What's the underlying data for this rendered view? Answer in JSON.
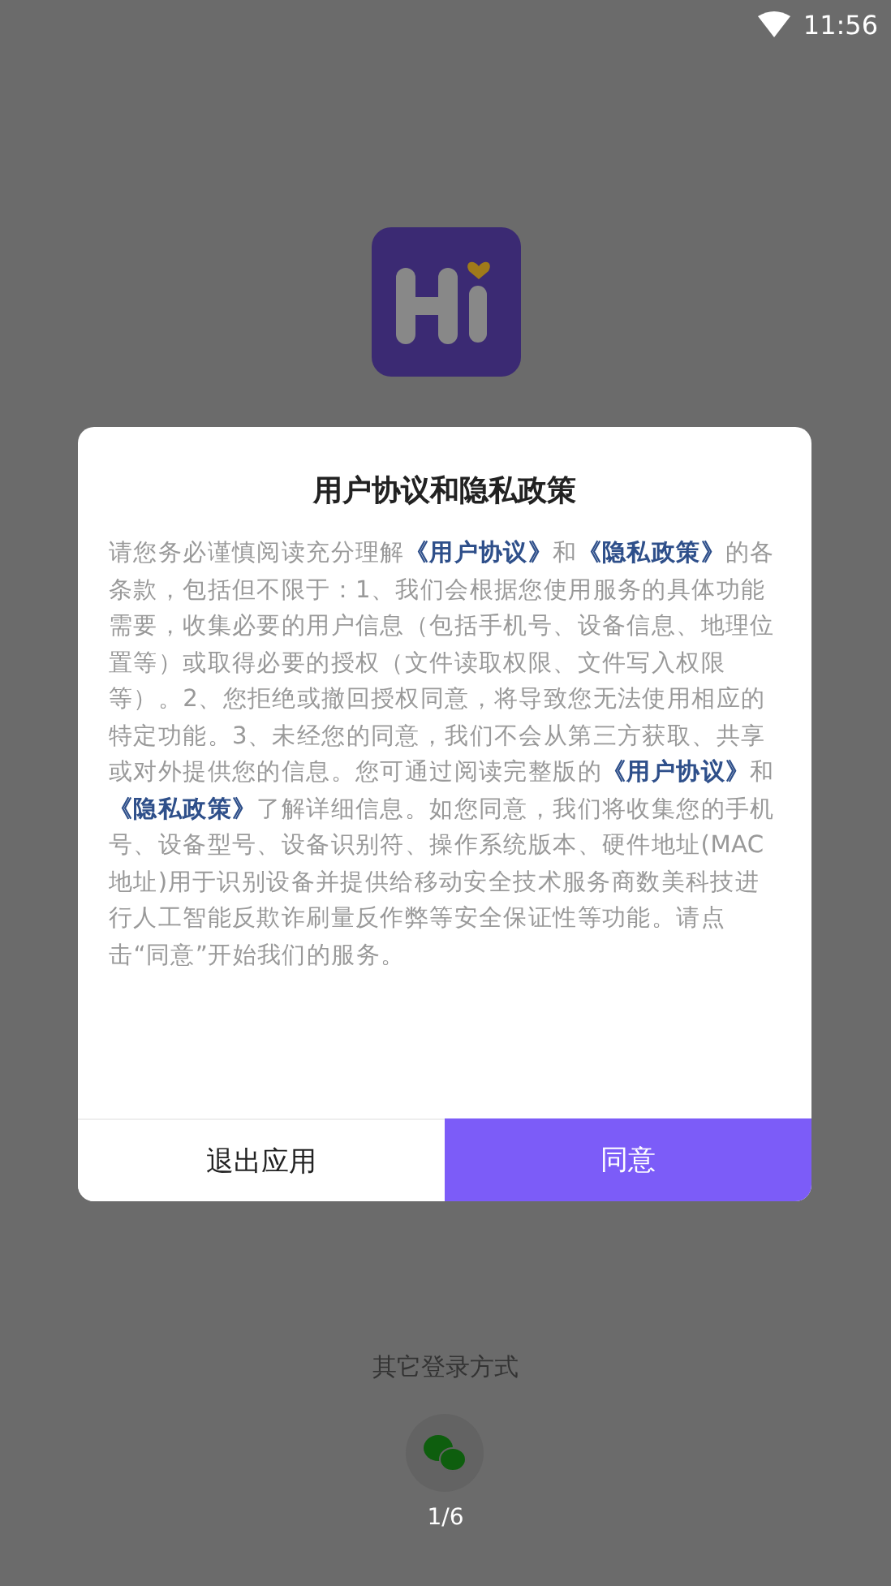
{
  "status_bar": {
    "time": "11:56"
  },
  "dialog": {
    "title": "用户协议和隐私政策",
    "body": "请您务必谨慎阅读充分理解**《用户协议》**和**《隐私政策》**的各条款，包括但不限于：1、我们会根据您使用服务的具体功能需要，收集必要的用户信息（包括手机号、设备信息、地理位置等）或取得必要的授权（文件读取权限、文件写入权限等）。2、您拒绝或撤回授权同意，将导致您无法使用相应的特定功能。3、未经您的同意，我们不会从第三方获取、共享或对外提供您的信息。您可通过阅读完整版的**《用户协议》**和**《隐私政策》**了解详细信息。如您同意，我们将收集您的手机号、设备型号、设备识别符、操作系统版本、硬件地址(MAC地址)用于识别设备并提供给移动安全技术服务商数美科技进行人工智能反欺诈刷量反作弊等安全保证性等功能。请点击“同意”开始我们的服务。",
    "buttons": [
      {
        "label": "退出应用",
        "kind": "secondary"
      },
      {
        "label": "同意",
        "kind": "primary"
      }
    ]
  },
  "other_login": {
    "label": "其它登录方式"
  },
  "page_indicator": "1/6"
}
